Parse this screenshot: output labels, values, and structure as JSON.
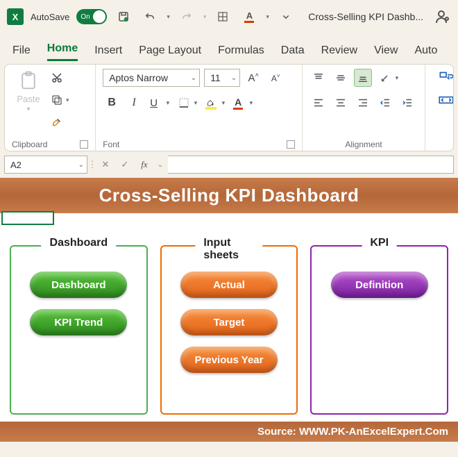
{
  "titlebar": {
    "autosave_label": "AutoSave",
    "autosave_state": "On",
    "doc_title": "Cross-Selling KPI Dashb..."
  },
  "tabs": {
    "file": "File",
    "home": "Home",
    "insert": "Insert",
    "page_layout": "Page Layout",
    "formulas": "Formulas",
    "data": "Data",
    "review": "Review",
    "view": "View",
    "automate": "Auto"
  },
  "ribbon": {
    "clipboard": {
      "paste": "Paste",
      "group_label": "Clipboard"
    },
    "font": {
      "name": "Aptos Narrow",
      "size": "11",
      "group_label": "Font"
    },
    "alignment": {
      "group_label": "Alignment"
    }
  },
  "namebox": {
    "value": "A2"
  },
  "formula_bar": {
    "value": ""
  },
  "dashboard": {
    "title": "Cross-Selling KPI Dashboard",
    "footer": "Source: WWW.PK-AnExcelExpert.Com",
    "panels": {
      "dashboard": {
        "title": "Dashboard",
        "buttons": [
          "Dashboard",
          "KPI Trend"
        ]
      },
      "input": {
        "title": "Input sheets",
        "buttons": [
          "Actual",
          "Target",
          "Previous Year"
        ]
      },
      "kpi": {
        "title": "KPI",
        "buttons": [
          "Definition"
        ]
      }
    }
  }
}
